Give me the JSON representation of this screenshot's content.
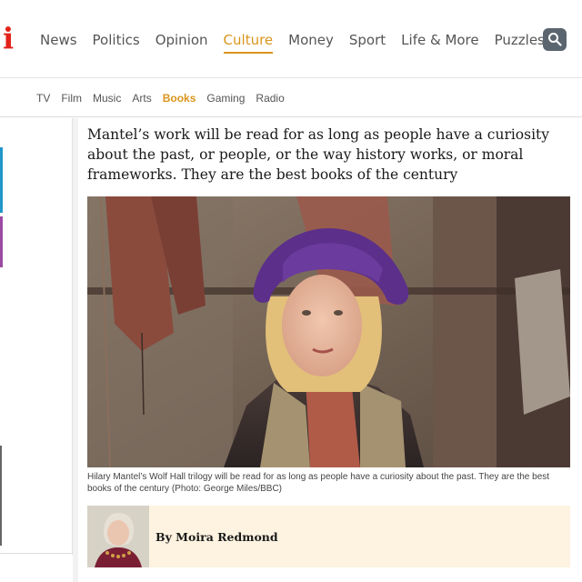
{
  "brand": {
    "logo_text": "i",
    "accent": "#e2231a"
  },
  "main_nav": {
    "items": [
      "News",
      "Politics",
      "Opinion",
      "Culture",
      "Money",
      "Sport",
      "Life & More",
      "Puzzles"
    ],
    "active": "Culture",
    "search_icon": "search-icon"
  },
  "sub_nav": {
    "items": [
      "TV",
      "Film",
      "Music",
      "Arts",
      "Books",
      "Gaming",
      "Radio"
    ],
    "active": "Books"
  },
  "article": {
    "pull_quote": "Mantel’s work will be read for as long as people have a curiosity about the past, or people, or the way history works, or moral frameworks. They are the best books of the century",
    "image_caption": "Hilary Mantel’s Wolf Hall trilogy will be read for as long as people have a curiosity about the past. They are the best books of the century (Photo: George Miles/BBC)",
    "byline": "By Moira Redmond"
  },
  "colors": {
    "culture_accent": "#d9951c",
    "byline_bg": "#fdf3e0",
    "search_bg": "#5b6570"
  }
}
